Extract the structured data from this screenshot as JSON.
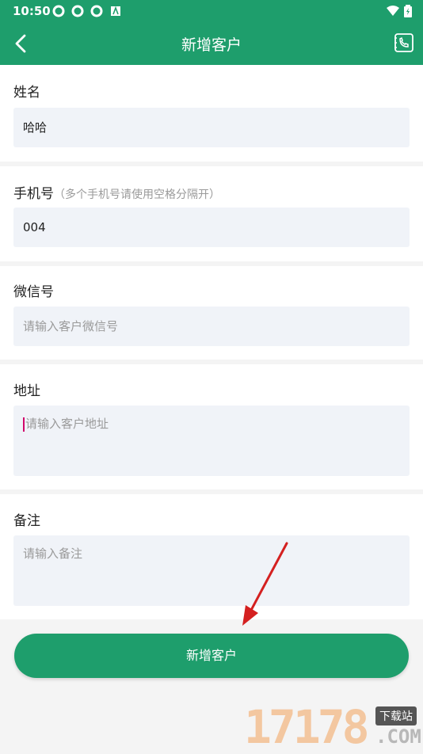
{
  "status_bar": {
    "time": "10:50"
  },
  "header": {
    "title": "新增客户"
  },
  "form": {
    "name": {
      "label": "姓名",
      "value": "哈哈"
    },
    "phone": {
      "label": "手机号",
      "hint": "（多个手机号请使用空格分隔开）",
      "value": "004"
    },
    "wechat": {
      "label": "微信号",
      "placeholder": "请输入客户微信号"
    },
    "address": {
      "label": "地址",
      "placeholder": "请输入客户地址"
    },
    "remark": {
      "label": "备注",
      "placeholder": "请输入备注"
    }
  },
  "submit_label": "新增客户",
  "watermark": {
    "number": "17178",
    "tag": "下载站",
    "domain": ".COM"
  },
  "colors": {
    "primary": "#1e9e6c",
    "field_bg": "#f0f3f8",
    "page_bg": "#f4f4f4"
  }
}
